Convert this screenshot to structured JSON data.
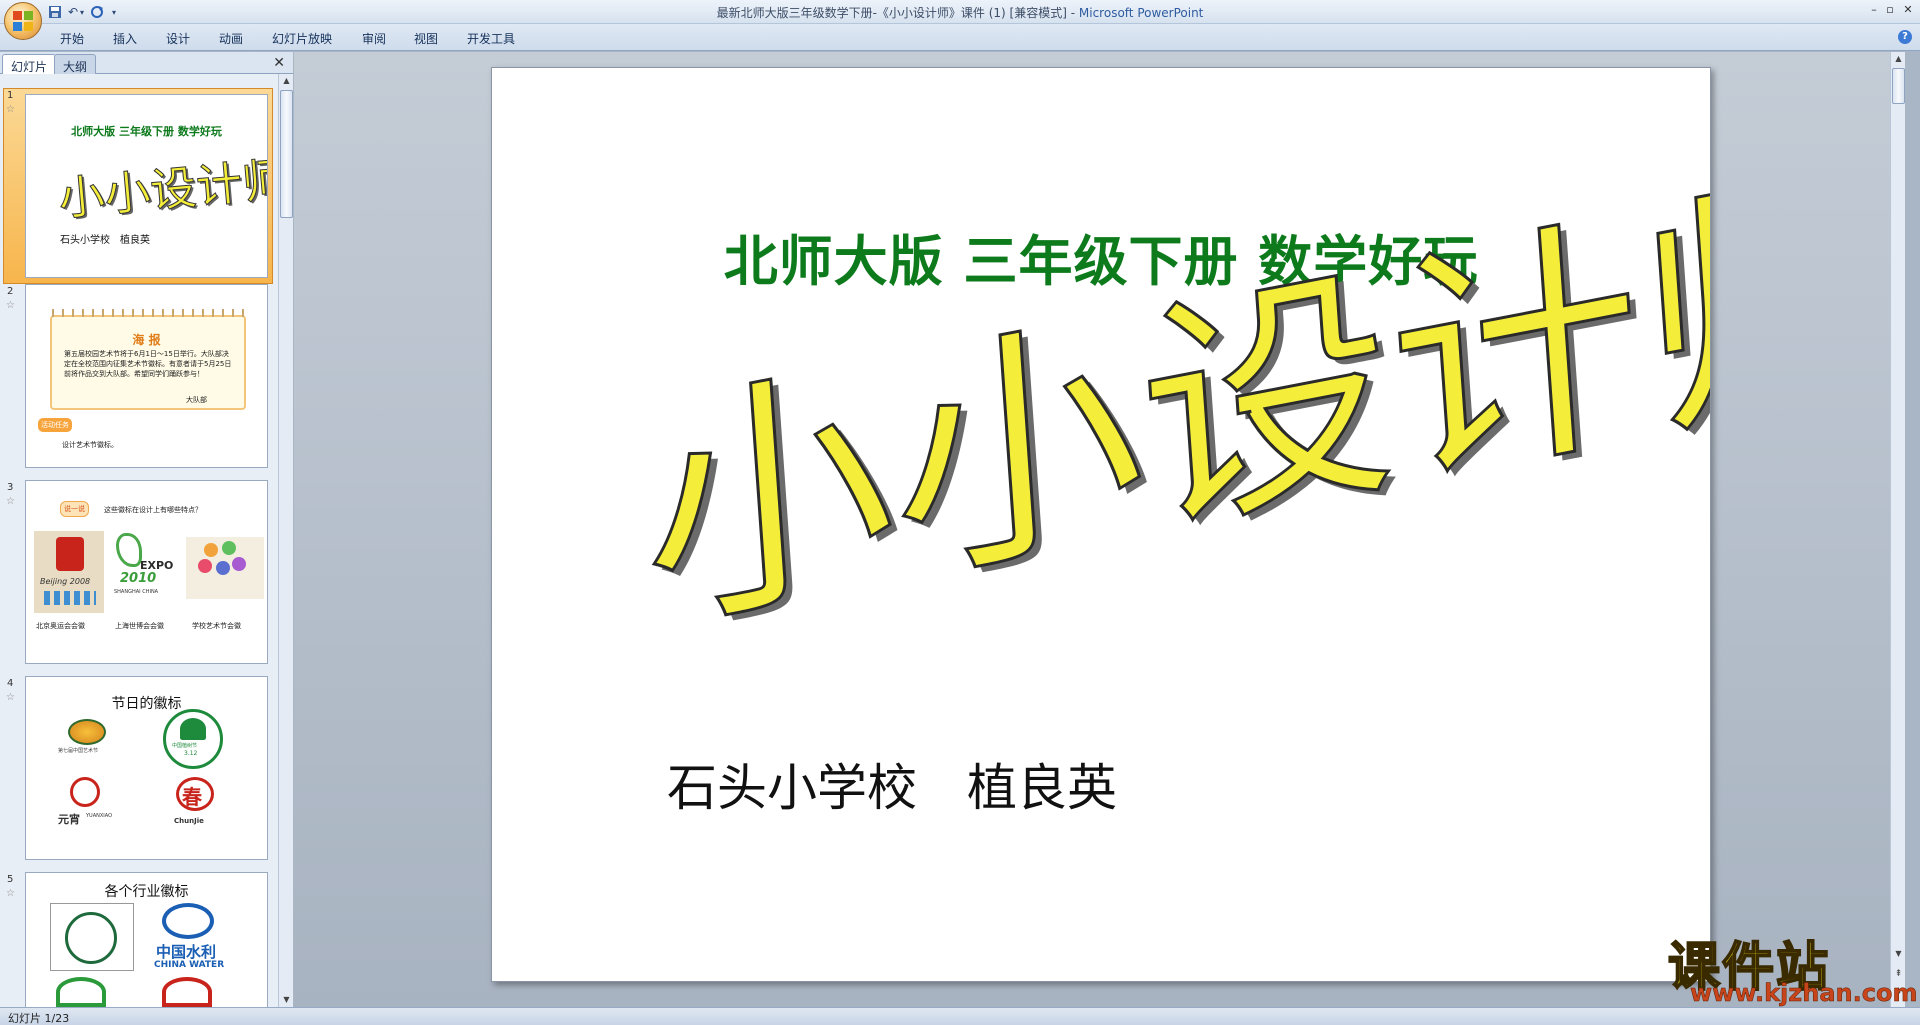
{
  "window": {
    "title": "最新北师大版三年级数学下册-《小小设计师》课件 (1) [兼容模式]",
    "title_sep": " - ",
    "app_name": "Microsoft PowerPoint"
  },
  "ribbon": {
    "tabs": [
      "开始",
      "插入",
      "设计",
      "动画",
      "幻灯片放映",
      "审阅",
      "视图",
      "开发工具"
    ]
  },
  "left_pane": {
    "tabs": [
      "幻灯片",
      "大纲"
    ],
    "slides": [
      {
        "number": "1",
        "subtitle": "北师大版 三年级下册 数学好玩",
        "title": "小小设计师",
        "author": "石头小学校　植良英"
      },
      {
        "number": "2",
        "poster_title": "海 报",
        "poster_body": "第五届校园艺术节将于6月1日～15日举行。大队部决定在全校范围内征集艺术节徽标。有意者请于5月25日前将作品交到大队部。希望同学们踊跃参与！",
        "poster_sign": "大队部",
        "badge": "活动任务",
        "task": "设计艺术节徽标。"
      },
      {
        "number": "3",
        "badge": "说一说",
        "question": "这些徽标在设计上有哪些特点？",
        "captions": [
          "北京奥运会会徽",
          "上海世博会会徽",
          "学校艺术节会徽"
        ],
        "logo_texts": [
          "Beijing 2008",
          "EXPO",
          "SHANGHAI CHINA",
          "2010"
        ]
      },
      {
        "number": "4",
        "title": "节日的徽标",
        "logo_texts": [
          "第七届中国艺术节",
          "中国植树节",
          "3.12",
          "元宵",
          "YUANXIAO",
          "春",
          "ChunJie"
        ]
      },
      {
        "number": "5",
        "title": "各个行业徽标",
        "logo_texts": [
          "中国水利",
          "CHINA WATER"
        ]
      }
    ]
  },
  "slide": {
    "subtitle": "北师大版 三年级下册 数学好玩",
    "title": "小小设计师",
    "author": "石头小学校　植良英"
  },
  "watermark": {
    "title": "课件站",
    "url": "www.kjzhan.com"
  },
  "status": {
    "text": "幻灯片 1/23"
  },
  "colors": {
    "subtitle_green": "#0d7a1c",
    "title_yellow": "#f4ee3a",
    "selection_orange": "#f7b54c"
  }
}
